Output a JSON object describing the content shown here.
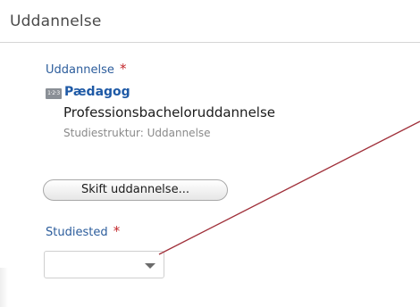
{
  "section": {
    "title": "Uddannelse"
  },
  "education": {
    "label": "Uddannelse",
    "required_mark": "*",
    "icon": "education-icon",
    "name": "Pædagog",
    "type": "Professionsbacheloruddannelse",
    "structure": "Studiestruktur: Uddannelse",
    "change_button_label": "Skift uddannelse..."
  },
  "study_place": {
    "label": "Studiested",
    "required_mark": "*",
    "selected_value": ""
  },
  "annotation": {
    "line_color": "#a0303a"
  },
  "colors": {
    "label": "#2c5d9c",
    "link": "#1f5aa6",
    "required": "#c3272b",
    "muted": "#8a8a8a"
  }
}
